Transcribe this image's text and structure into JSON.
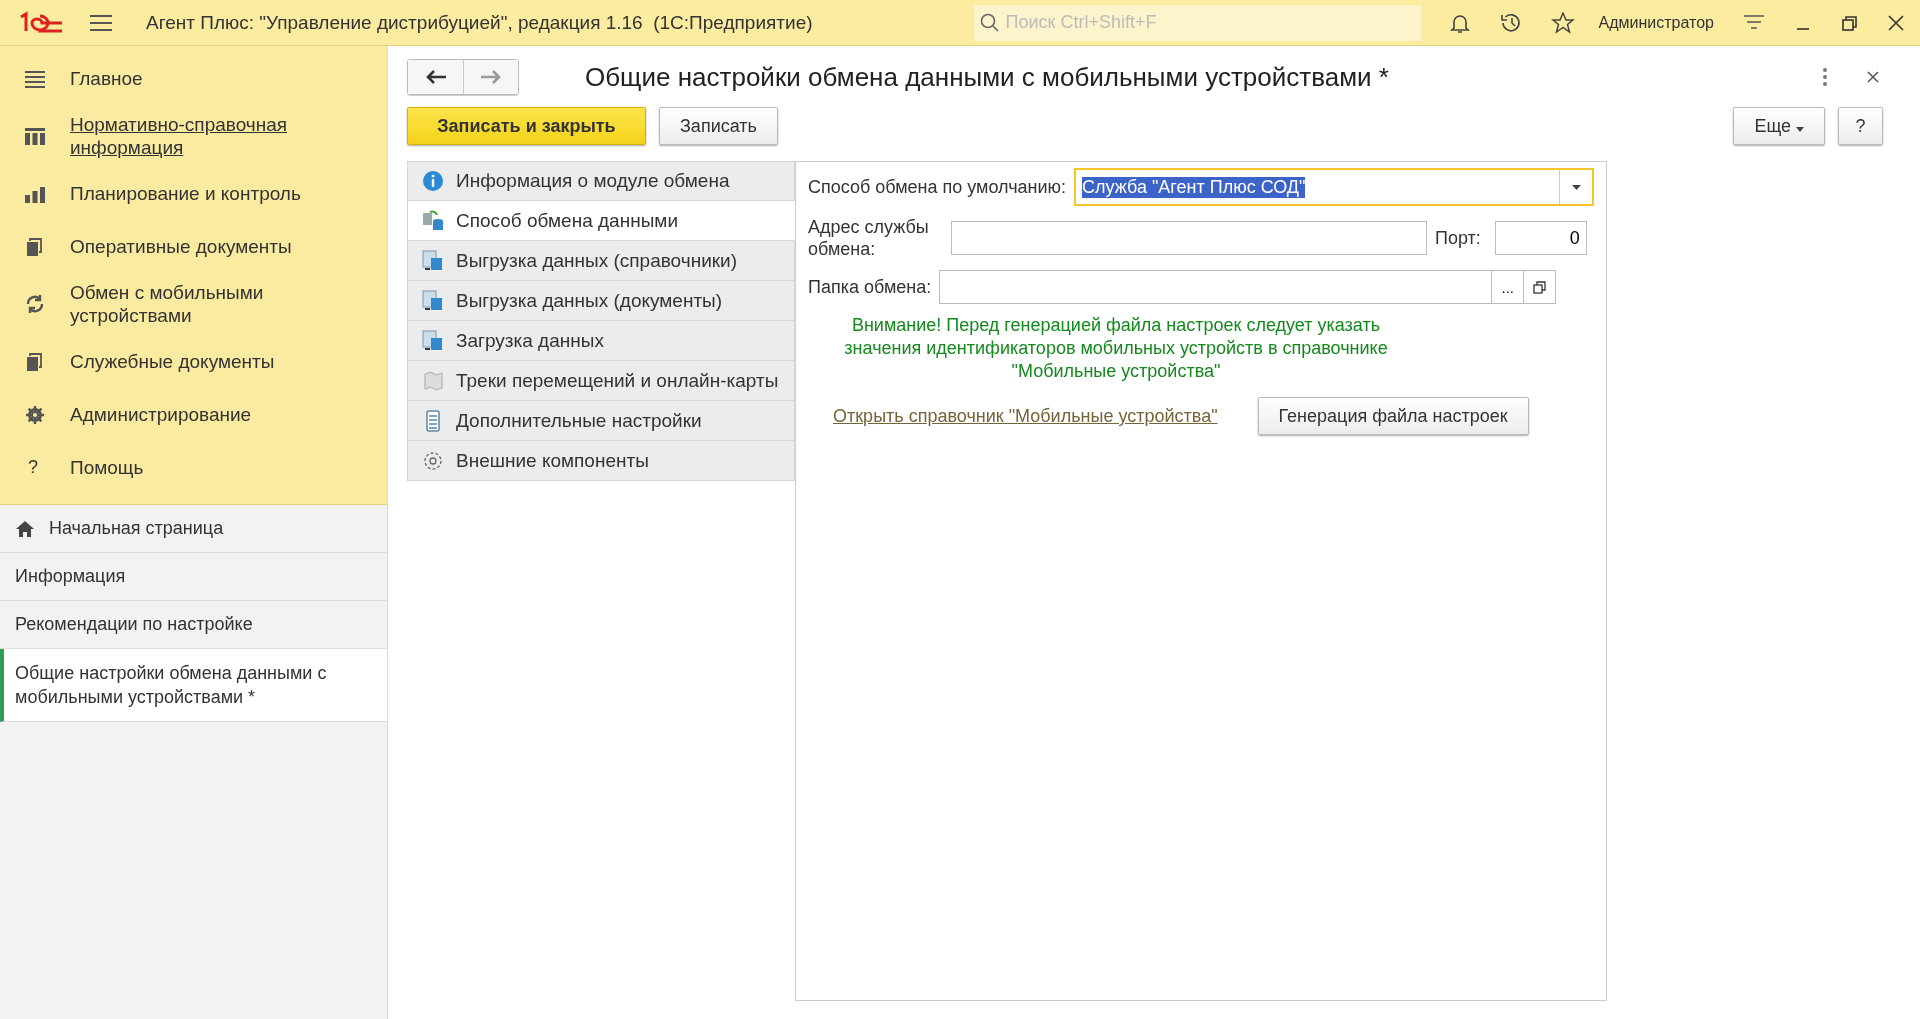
{
  "window": {
    "title": "Агент Плюс: \"Управление дистрибуцией\", редакция 1.16  (1С:Предприятие)",
    "search_placeholder": "Поиск Ctrl+Shift+F",
    "user": "Администратор"
  },
  "sections": [
    {
      "label": "Главное",
      "kind": "menu",
      "underlined": false
    },
    {
      "label": "Нормативно-справочная информация",
      "kind": "catalog",
      "underlined": true
    },
    {
      "label": "Планирование и контроль",
      "kind": "chart",
      "underlined": false
    },
    {
      "label": "Оперативные документы",
      "kind": "docs",
      "underlined": false
    },
    {
      "label": "Обмен с мобильными устройствами",
      "kind": "sync",
      "underlined": false
    },
    {
      "label": "Служебные документы",
      "kind": "docs",
      "underlined": false
    },
    {
      "label": "Администрирование",
      "kind": "gear",
      "underlined": false
    },
    {
      "label": "Помощь",
      "kind": "help",
      "icon_text": "?",
      "underlined": false
    }
  ],
  "open_pages": [
    {
      "label": "Начальная страница",
      "home": true,
      "selected": false
    },
    {
      "label": "Информация",
      "home": false,
      "selected": false
    },
    {
      "label": "Рекомендации по настройке",
      "home": false,
      "selected": false
    },
    {
      "label": "Общие настройки обмена данными с мобильными устройствами *",
      "home": false,
      "selected": true
    }
  ],
  "form": {
    "title": "Общие настройки обмена данными с мобильными устройствами *",
    "buttons": [
      {
        "label": "Записать и закрыть",
        "kind": "primary"
      },
      {
        "label": "Записать",
        "kind": "normal"
      }
    ],
    "more_button": "Еще",
    "help_button": "?",
    "tabs": [
      {
        "label": "Информация о модуле обмена",
        "kind": "info",
        "selected": false
      },
      {
        "label": "Способ обмена данными",
        "kind": "exchange",
        "selected": true
      },
      {
        "label": "Выгрузка данных (справочники)",
        "kind": "upload",
        "selected": false
      },
      {
        "label": "Выгрузка данных (документы)",
        "kind": "upload",
        "selected": false
      },
      {
        "label": "Загрузка данных",
        "kind": "upload",
        "selected": false
      },
      {
        "label": "Треки перемещений и онлайн-карты",
        "kind": "map",
        "selected": false
      },
      {
        "label": "Дополнительные настройки",
        "kind": "list",
        "selected": false
      },
      {
        "label": "Внешние компоненты",
        "kind": "gear",
        "selected": false
      }
    ],
    "method_label": "Способ обмена по умолчанию:",
    "method_value": "Служба \"Агент Плюс СОД\"",
    "address_label": "Адрес службы обмена:",
    "port_label": "Порт:",
    "port_value": "0",
    "folder_label": "Папка обмена:",
    "folder_button": "...",
    "warning": "Внимание! Перед генерацией файла настроек следует указать значения идентификаторов мобильных устройств в справочнике \"Мобильные устройства\"",
    "link": "Открыть справочник \"Мобильные устройства\"",
    "generate_button": "Генерация файла настроек"
  }
}
